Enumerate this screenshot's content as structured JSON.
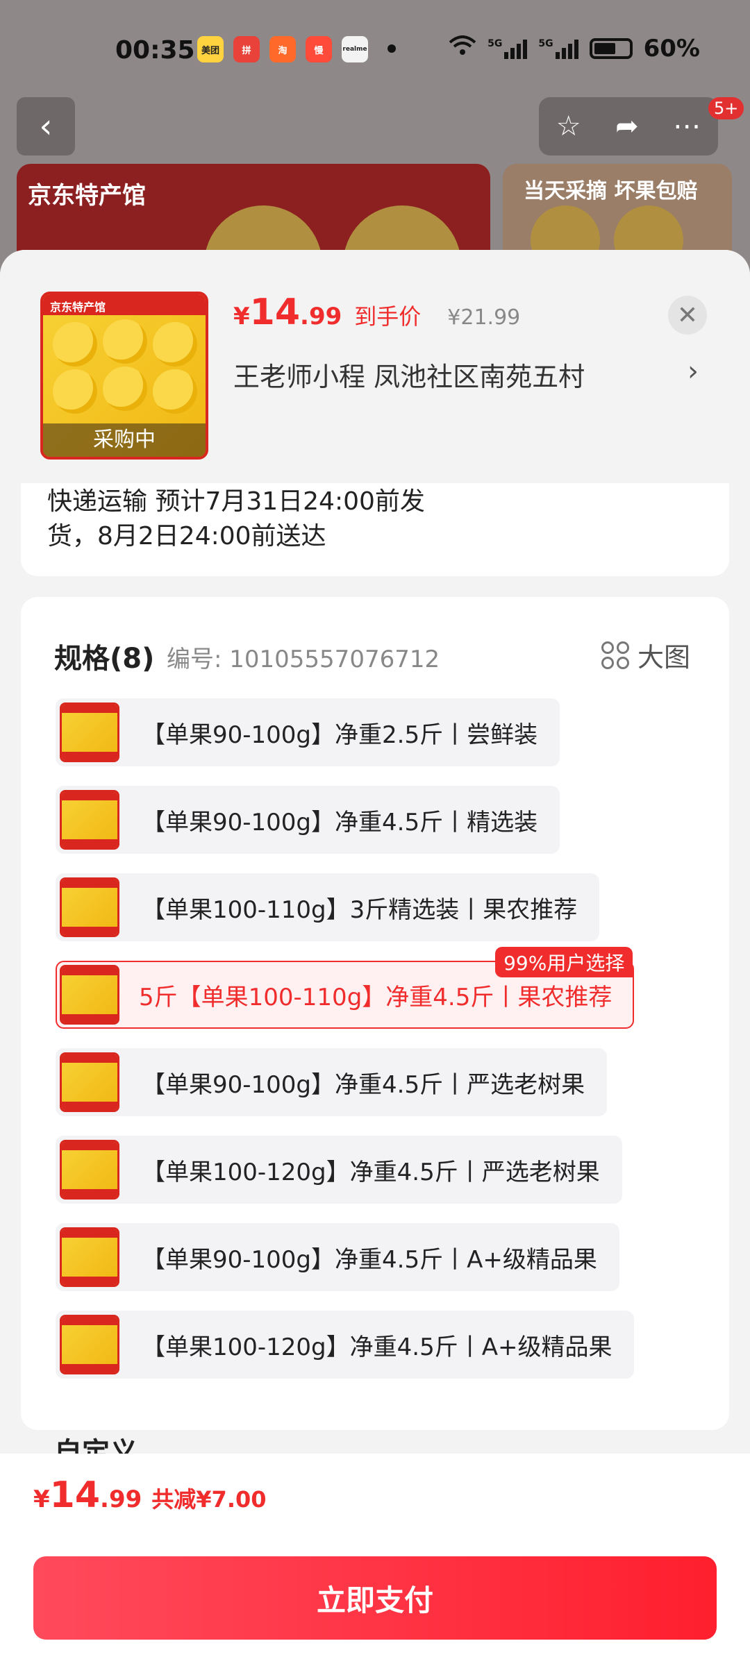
{
  "status_bar": {
    "time": "00:35",
    "battery_text": "60%",
    "network_1": "5G",
    "network_2": "5G",
    "apps": [
      {
        "name": "美团",
        "color": "#ffd23f"
      },
      {
        "name": "拼",
        "color": "#e8423a"
      },
      {
        "name": "淘",
        "color": "#ff6a2b"
      },
      {
        "name": "慢",
        "color": "#ff4b3a"
      },
      {
        "name": "realme",
        "color": "#f3f3f3"
      }
    ]
  },
  "top_bar": {
    "notification_badge": "5+",
    "banner_logo": "京东特产馆",
    "banner_right_text": "当天采摘 坏果包赔"
  },
  "product": {
    "currency": "¥",
    "price_int": "14",
    "price_dec": ".99",
    "price_label": "到手价",
    "original_price": "¥21.99",
    "thumb_logo": "京东特产馆",
    "thumb_status": "采购中",
    "address": "王老师小程  凤池社区南苑五村"
  },
  "delivery": {
    "text": "快递运输 预计7月31日24:00前发货，8月2日24:00前送达"
  },
  "spec": {
    "title": "规格(8)",
    "code": "编号: 10105557076712",
    "big_image_label": "大图",
    "options": [
      {
        "label": "【单果90-100g】净重2.5斤丨尝鲜装"
      },
      {
        "label": "【单果90-100g】净重4.5斤丨精选装"
      },
      {
        "label": "【单果100-110g】3斤精选装丨果农推荐"
      },
      {
        "label": "5斤【单果100-110g】净重4.5斤丨果农推荐",
        "badge": "99%用户选择"
      },
      {
        "label": "【单果90-100g】净重4.5斤丨严选老树果"
      },
      {
        "label": "【单果100-120g】净重4.5斤丨严选老树果"
      },
      {
        "label": "【单果90-100g】净重4.5斤丨A+级精品果"
      },
      {
        "label": "【单果100-120g】净重4.5斤丨A+级精品果"
      }
    ],
    "custom_label": "自定义"
  },
  "footer": {
    "currency": "¥",
    "price_int": "14",
    "price_dec": ".99",
    "savings": "共减¥7.00",
    "pay_button": "立即支付"
  },
  "colors": {
    "accent": "#f02c2c",
    "pay_gradient_start": "#ff4a5c",
    "pay_gradient_end": "#ff1f2e"
  },
  "icons": [
    "back-arrow-icon",
    "star-icon",
    "share-icon",
    "more-icon",
    "close-icon",
    "chevron-right-icon",
    "grid-icon"
  ]
}
